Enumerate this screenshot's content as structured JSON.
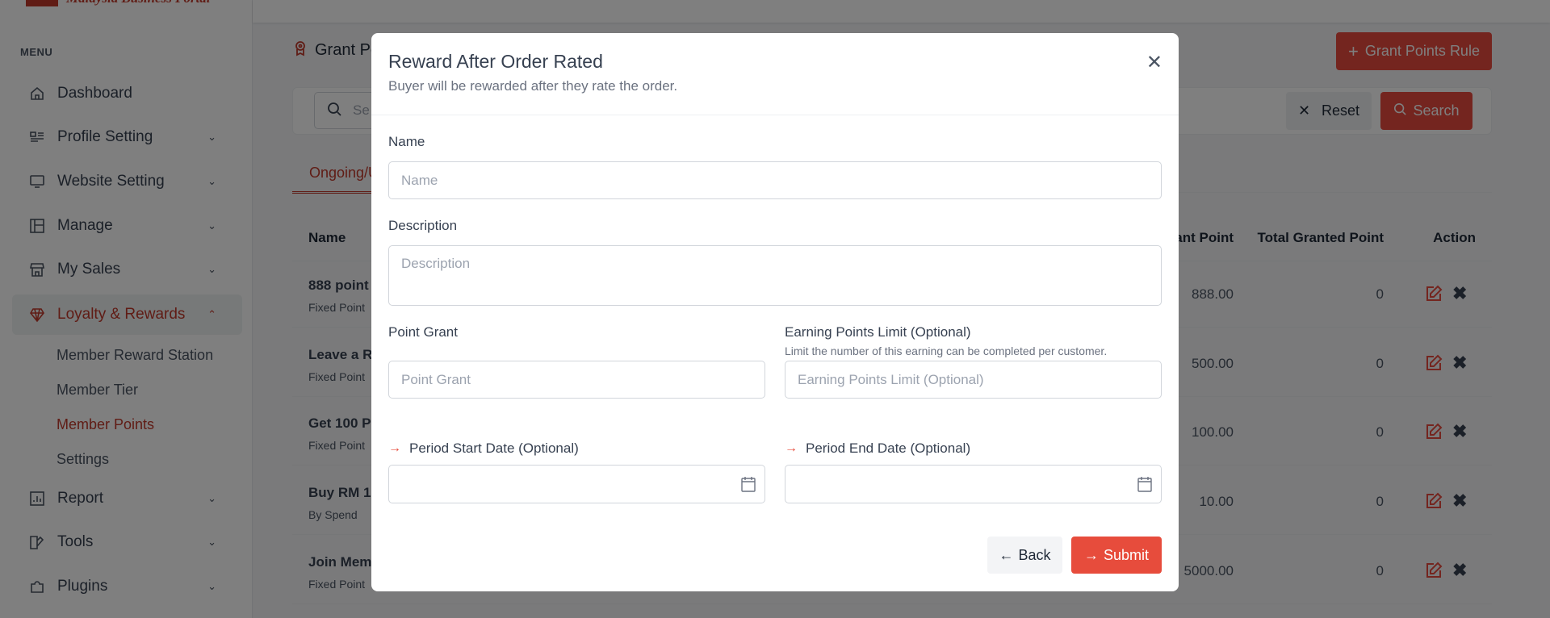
{
  "brand": {
    "logo_text": "Malaysia Business Portal",
    "accent": "#e94b3f"
  },
  "sidebar": {
    "menu_label": "MENU",
    "items": [
      {
        "label": "Dashboard",
        "icon": "home-icon"
      },
      {
        "label": "Profile Setting",
        "icon": "profile-icon"
      },
      {
        "label": "Website Setting",
        "icon": "monitor-icon"
      },
      {
        "label": "Manage",
        "icon": "layout-icon"
      },
      {
        "label": "My Sales",
        "icon": "store-icon"
      },
      {
        "label": "Loyalty & Rewards",
        "icon": "diamond-icon"
      },
      {
        "label": "Report",
        "icon": "chart-icon"
      },
      {
        "label": "Tools",
        "icon": "tools-icon"
      },
      {
        "label": "Plugins",
        "icon": "puzzle-icon"
      }
    ],
    "loyalty_sub": [
      "Member Reward Station",
      "Member Tier",
      "Member Points",
      "Settings"
    ]
  },
  "page": {
    "title": "Grant Po",
    "grant_button": "Grant Points Rule",
    "search_placeholder": "Se",
    "reset_label": "Reset",
    "search_label": "Search",
    "tab": "Ongoing/U",
    "table": {
      "headers": {
        "name": "Name",
        "grant_point": "ant Point",
        "total": "Total Granted Point",
        "action": "Action"
      },
      "rows": [
        {
          "name": "888 point",
          "type": "Fixed Point",
          "grant": "888.00",
          "total": "0"
        },
        {
          "name": "Leave a R",
          "type": "Fixed Point",
          "grant": "500.00",
          "total": "0"
        },
        {
          "name": "Get 100 P",
          "type": "Fixed Point",
          "grant": "100.00",
          "total": "0"
        },
        {
          "name": "Buy RM 1",
          "type": "By Spend",
          "grant": "10.00",
          "total": "0"
        },
        {
          "name": "Join Mem",
          "type": "Fixed Point",
          "grant": "5000.00",
          "total": "0"
        }
      ]
    }
  },
  "modal": {
    "title": "Reward After Order Rated",
    "subtitle": "Buyer will be rewarded after they rate the order.",
    "name_label": "Name",
    "name_placeholder": "Name",
    "desc_label": "Description",
    "desc_placeholder": "Description",
    "point_label": "Point Grant",
    "point_placeholder": "Point Grant",
    "limit_label": "Earning Points Limit (Optional)",
    "limit_help": "Limit the number of this earning can be completed per customer.",
    "limit_placeholder": "Earning Points Limit (Optional)",
    "start_label": "Period Start Date (Optional)",
    "end_label": "Period End Date (Optional)",
    "back_label": "Back",
    "submit_label": "Submit",
    "submit_color": "#e74c3c"
  }
}
